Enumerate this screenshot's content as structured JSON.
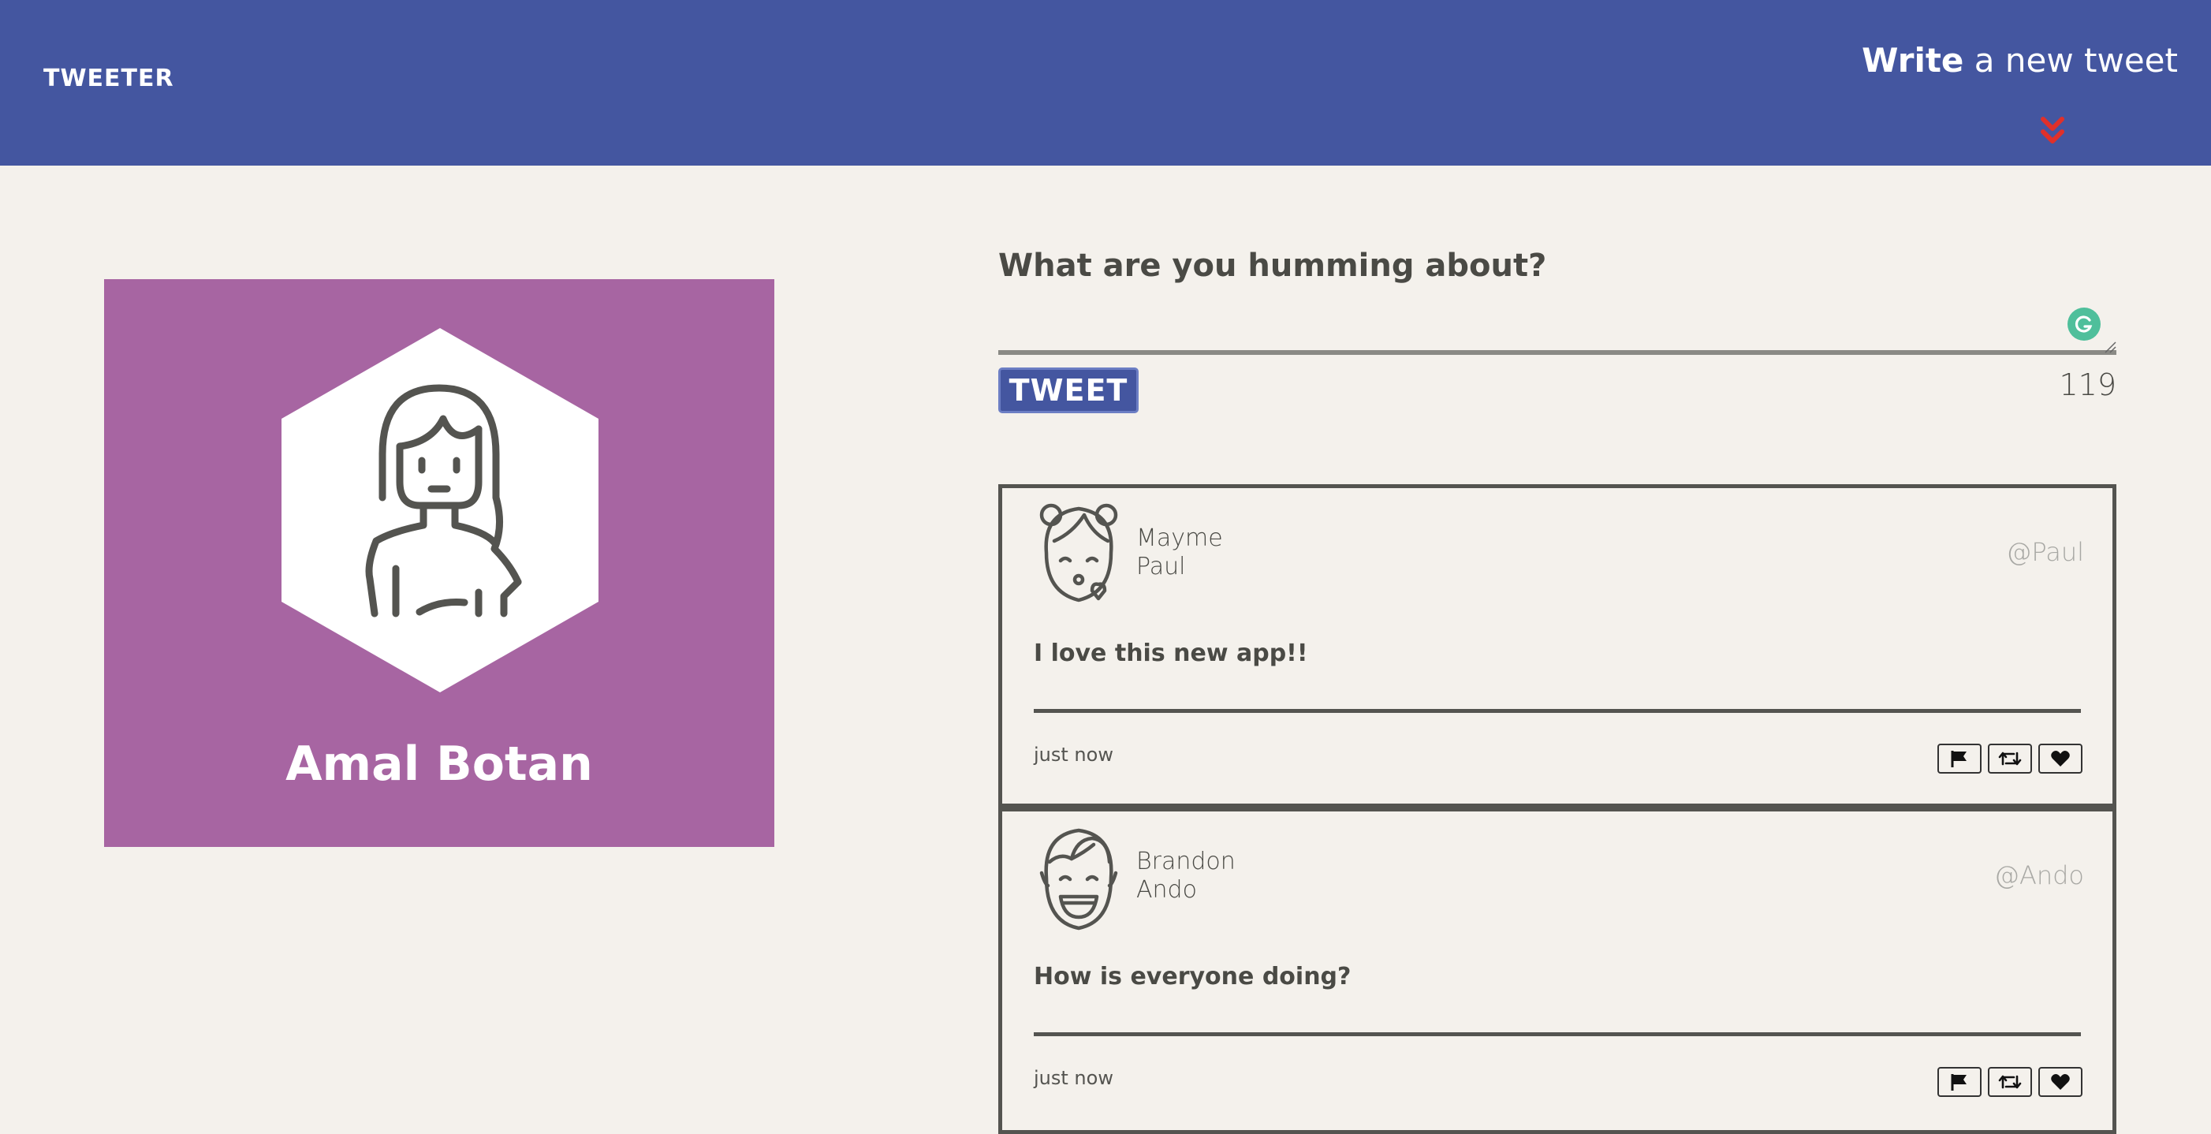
{
  "nav": {
    "brand": "TWEETER",
    "compose_toggle_bold": "Write",
    "compose_toggle_rest": " a new tweet",
    "toggle_icon": "chevron-double-down-icon",
    "accent_color": "#e0302a",
    "bg_color": "#4456a0"
  },
  "profile": {
    "name": "Amal Botan",
    "bg_color": "#a765a2",
    "avatar_icon": "girl-avatar-icon"
  },
  "compose": {
    "label": "What are you humming about?",
    "value": "",
    "button_label": "TWEET",
    "counter": "119"
  },
  "tweets": [
    {
      "first_name": "Mayme",
      "last_name": "Paul",
      "handle": "@Paul",
      "body": "I love this new app!!",
      "time": "just now",
      "avatar_icon": "kissing-face-avatar-icon"
    },
    {
      "first_name": "Brandon",
      "last_name": "Ando",
      "handle": "@Ando",
      "body": "How is everyone doing?",
      "time": "just now",
      "avatar_icon": "laughing-face-avatar-icon"
    }
  ],
  "tweet_actions": [
    "flag-icon",
    "retweet-icon",
    "heart-icon"
  ]
}
